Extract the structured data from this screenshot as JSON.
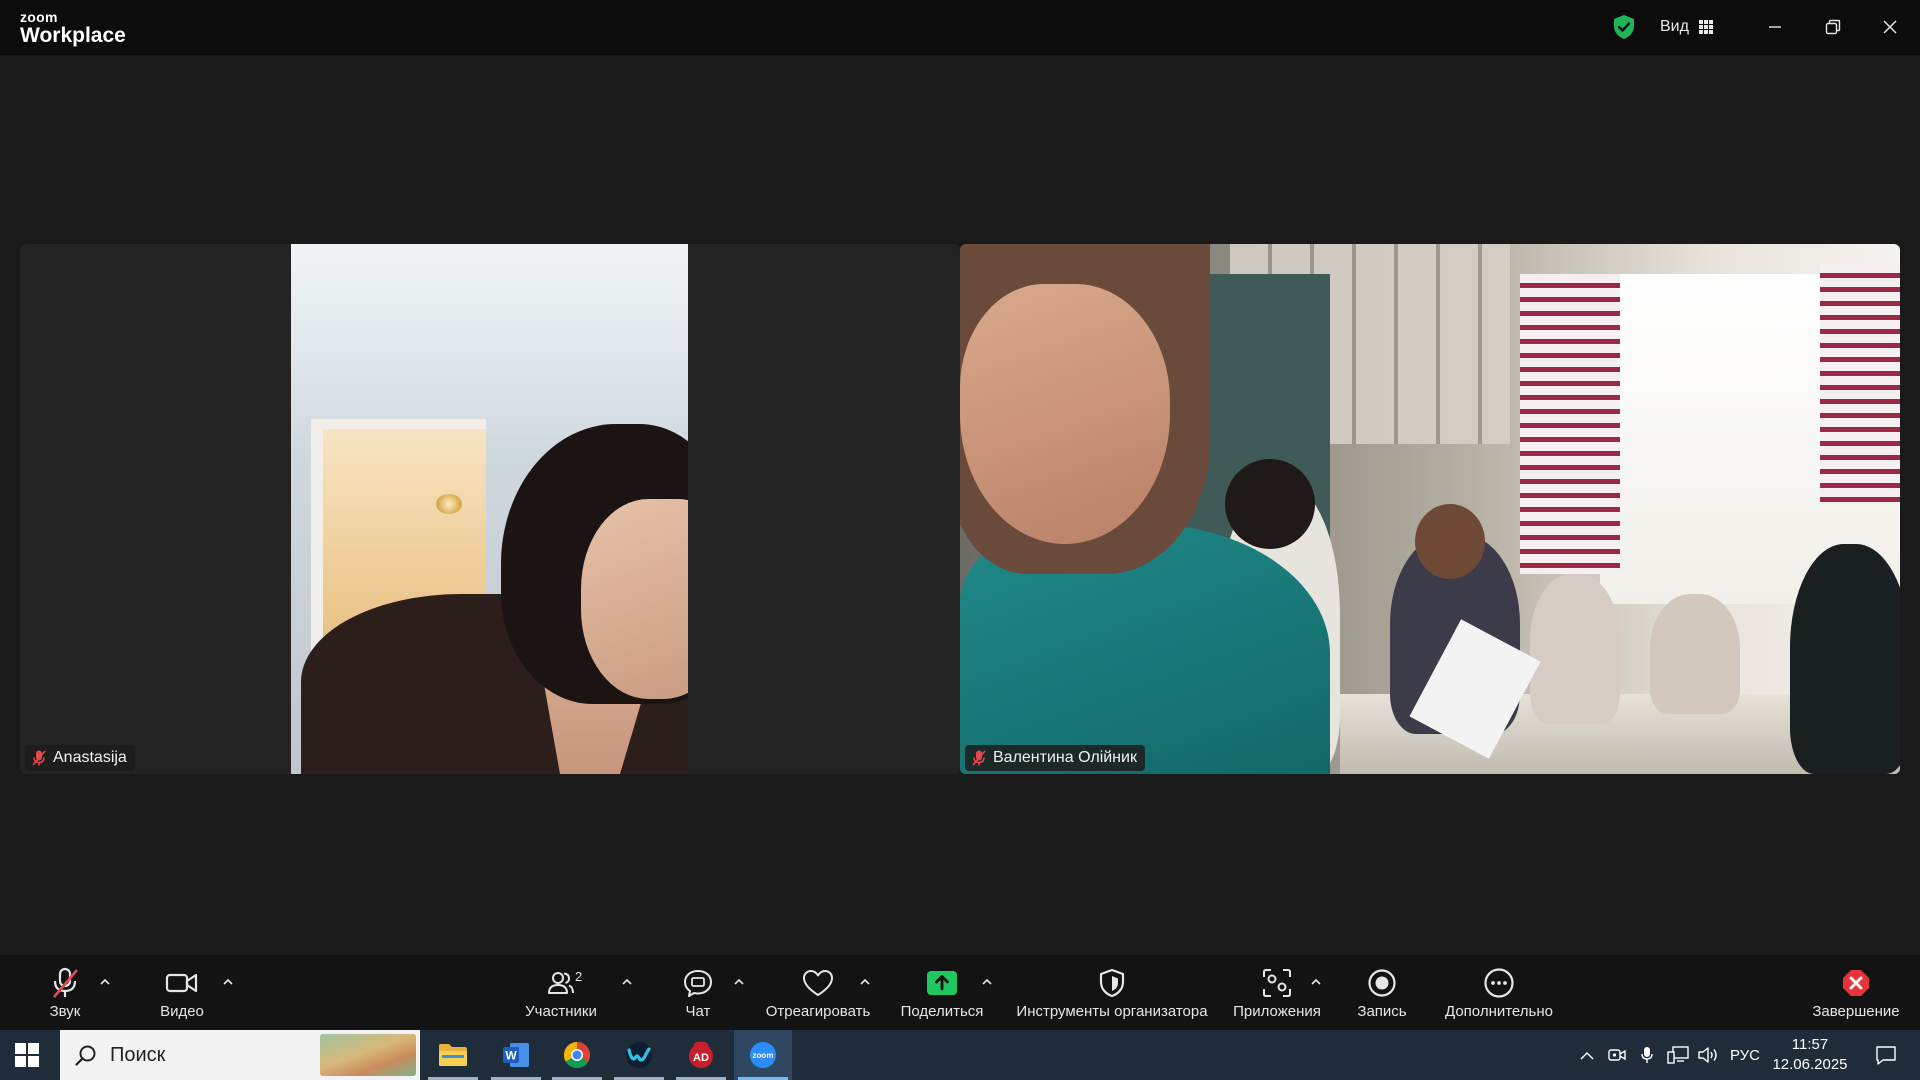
{
  "titlebar": {
    "logo_small": "zoom",
    "logo_big": "Workplace",
    "view_label": "Вид"
  },
  "participants": [
    {
      "name": "Anastasija",
      "muted": true
    },
    {
      "name": "Валентина Олійник",
      "muted": true
    }
  ],
  "toolbar": {
    "audio_label": "Звук",
    "video_label": "Видео",
    "participants_label": "Участники",
    "participants_count": "2",
    "chat_label": "Чат",
    "react_label": "Отреагировать",
    "share_label": "Поделиться",
    "host_tools_label": "Инструменты организатора",
    "apps_label": "Приложения",
    "record_label": "Запись",
    "more_label": "Дополнительно",
    "end_label": "Завершение"
  },
  "taskbar": {
    "search_placeholder": "Поиск",
    "apps": [
      "file-explorer",
      "word",
      "chrome",
      "webex",
      "adobe-reader",
      "zoom"
    ],
    "language": "РУС",
    "time": "11:57",
    "date": "12.06.2025"
  },
  "colors": {
    "shield_green": "#1fb35a",
    "share_green": "#1fc960",
    "end_red": "#e5343a",
    "muted_red": "#e5484d"
  }
}
